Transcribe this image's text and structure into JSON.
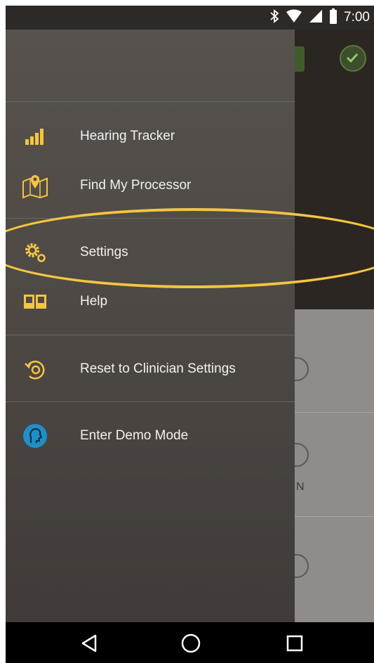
{
  "status_bar": {
    "time": "7:00",
    "icons": [
      "bluetooth-icon",
      "wifi-icon",
      "cell-signal-icon",
      "battery-icon"
    ]
  },
  "drawer": {
    "items": [
      {
        "label": "Hearing Tracker",
        "icon": "signal-bars-icon"
      },
      {
        "label": "Find My Processor",
        "icon": "map-pin-icon"
      },
      {
        "label": "Settings",
        "icon": "gears-icon"
      },
      {
        "label": "Help",
        "icon": "book-icon"
      },
      {
        "label": "Reset to Clinician Settings",
        "icon": "reset-icon"
      },
      {
        "label": "Enter Demo Mode",
        "icon": "demo-head-icon"
      }
    ]
  },
  "background_app": {
    "partial_text": "N"
  },
  "nav_bar": {
    "buttons": [
      "back-icon",
      "home-icon",
      "recents-icon"
    ]
  },
  "colors": {
    "accent": "#f4c542",
    "drawer_bg": "#4d4844",
    "demo_icon": "#1f8fc9"
  }
}
